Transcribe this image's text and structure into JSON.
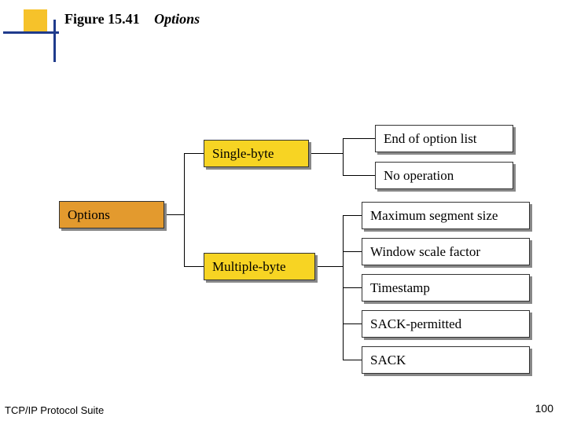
{
  "header": {
    "figure_label": "Figure 15.41",
    "figure_title": "Options"
  },
  "footer": {
    "left": "TCP/IP Protocol Suite",
    "right": "100"
  },
  "diagram": {
    "root": "Options",
    "mid": {
      "single": "Single-byte",
      "multiple": "Multiple-byte"
    },
    "leaves": {
      "end_of_option": "End of option list",
      "no_op": "No operation",
      "mss": "Maximum segment size",
      "wsf": "Window scale factor",
      "timestamp": "Timestamp",
      "sack_perm": "SACK-permitted",
      "sack": "SACK"
    }
  }
}
